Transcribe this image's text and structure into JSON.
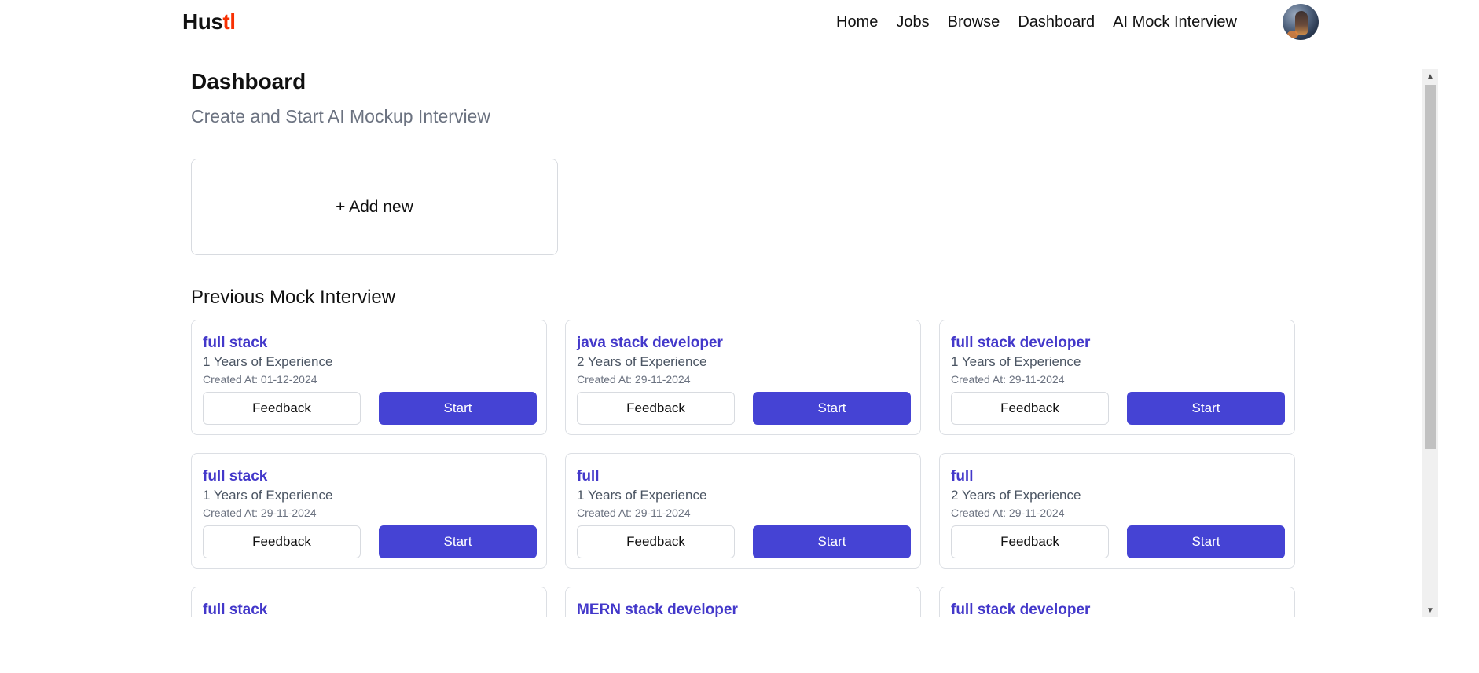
{
  "navbar": {
    "logo_main": "Hus",
    "logo_accent": "tl",
    "links": [
      "Home",
      "Jobs",
      "Browse",
      "Dashboard",
      "AI Mock Interview"
    ]
  },
  "dashboard": {
    "title": "Dashboard",
    "subtitle": "Create and Start AI Mockup Interview",
    "add_new_label": "+ Add new",
    "previous_title": "Previous Mock Interview"
  },
  "colors": {
    "accent_logo": "#f83002",
    "primary_button": "#4543d4",
    "position_text": "#4338ca"
  },
  "interviews": [
    {
      "position": "full stack",
      "experience": "1 Years of Experience",
      "created": "Created At: 01-12-2024",
      "feedback_label": "Feedback",
      "start_label": "Start"
    },
    {
      "position": "java stack developer",
      "experience": "2 Years of Experience",
      "created": "Created At: 29-11-2024",
      "feedback_label": "Feedback",
      "start_label": "Start"
    },
    {
      "position": "full stack developer",
      "experience": "1 Years of Experience",
      "created": "Created At: 29-11-2024",
      "feedback_label": "Feedback",
      "start_label": "Start"
    },
    {
      "position": "full stack",
      "experience": "1 Years of Experience",
      "created": "Created At: 29-11-2024",
      "feedback_label": "Feedback",
      "start_label": "Start"
    },
    {
      "position": "full",
      "experience": "1 Years of Experience",
      "created": "Created At: 29-11-2024",
      "feedback_label": "Feedback",
      "start_label": "Start"
    },
    {
      "position": "full",
      "experience": "2 Years of Experience",
      "created": "Created At: 29-11-2024",
      "feedback_label": "Feedback",
      "start_label": "Start"
    },
    {
      "position": "full stack"
    },
    {
      "position": "MERN stack developer"
    },
    {
      "position": "full stack developer"
    }
  ]
}
